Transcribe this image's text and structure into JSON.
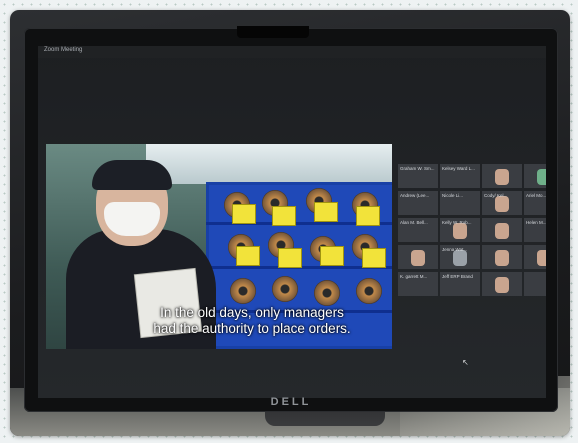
{
  "meeting_app": {
    "title": "Zoom Meeting"
  },
  "monitor": {
    "brand": "DELL"
  },
  "shared_video": {
    "subtitle_line1": "In the old days, only managers",
    "subtitle_line2": "had the authority to place orders."
  },
  "participants": [
    {
      "name": "Graham W. Sm...",
      "face": "none"
    },
    {
      "name": "Kelsey Ward L...",
      "face": "none"
    },
    {
      "name": "",
      "face": "skin"
    },
    {
      "name": "",
      "face": "green"
    },
    {
      "name": "Andrew (Lee...",
      "face": "none"
    },
    {
      "name": "Nicole Li...",
      "face": "none"
    },
    {
      "name": "Cody/ Kel...",
      "face": "skin"
    },
    {
      "name": "Ariel Mo...",
      "face": "none"
    },
    {
      "name": "Alan M. Bell...",
      "face": "none"
    },
    {
      "name": "Kelly W. Rob...",
      "face": "skin"
    },
    {
      "name": "",
      "face": "skin"
    },
    {
      "name": "Helen M...",
      "face": "none"
    },
    {
      "name": "",
      "face": "skin"
    },
    {
      "name": "Jenna Wat...",
      "face": "gray"
    },
    {
      "name": "",
      "face": "skin"
    },
    {
      "name": "",
      "face": "skin"
    },
    {
      "name": "K. garrett M...",
      "face": "none"
    },
    {
      "name": "Jeff ERP Brand",
      "face": "none"
    },
    {
      "name": "",
      "face": "skin"
    },
    {
      "name": "",
      "face": "none"
    }
  ]
}
